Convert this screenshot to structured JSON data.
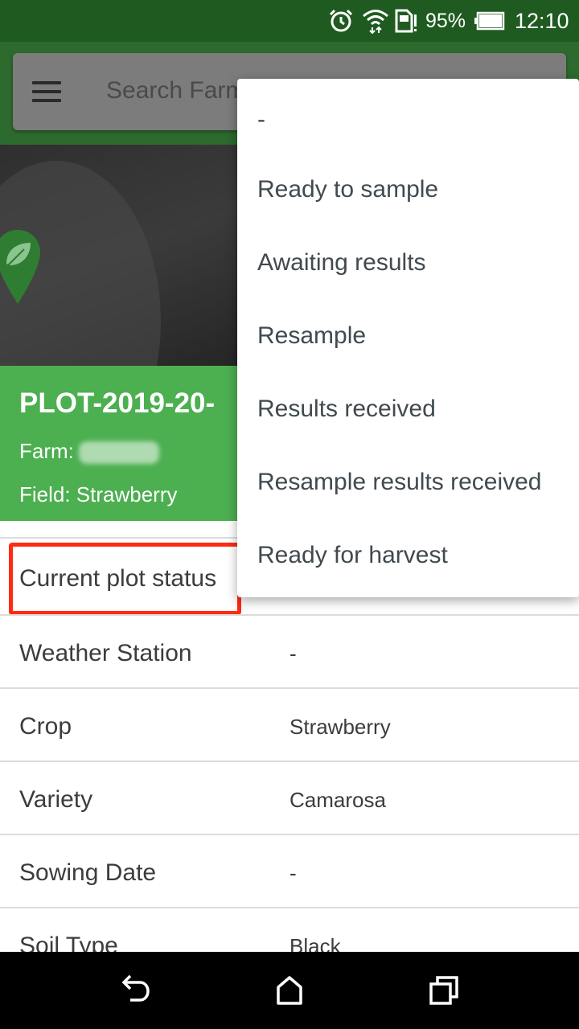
{
  "status_bar": {
    "battery_percent": "95%",
    "time": "12:10",
    "icons": [
      "alarm-icon",
      "wifi-icon",
      "sim-icon",
      "battery-icon"
    ]
  },
  "header": {
    "search_placeholder": "Search Farms"
  },
  "plot": {
    "title": "PLOT-2019-20-",
    "farm_label": "Farm:",
    "field": "Field: Strawberry"
  },
  "details": {
    "current_status_label": "Current plot status",
    "rows": [
      {
        "label": "Weather Station",
        "value": "-"
      },
      {
        "label": "Crop",
        "value": "Strawberry"
      },
      {
        "label": "Variety",
        "value": "Camarosa"
      },
      {
        "label": "Sowing Date",
        "value": "-"
      },
      {
        "label": "Soil Type",
        "value": "Black"
      }
    ]
  },
  "status_menu": {
    "options": [
      "-",
      "Ready to sample",
      "Awaiting results",
      "Resample",
      "Results received",
      "Resample results received",
      "Ready for harvest"
    ]
  },
  "colors": {
    "status_bar": "#1f5b20",
    "header": "#2d6a2e",
    "plot_panel": "#4caf50",
    "highlight": "#ff2a12"
  }
}
